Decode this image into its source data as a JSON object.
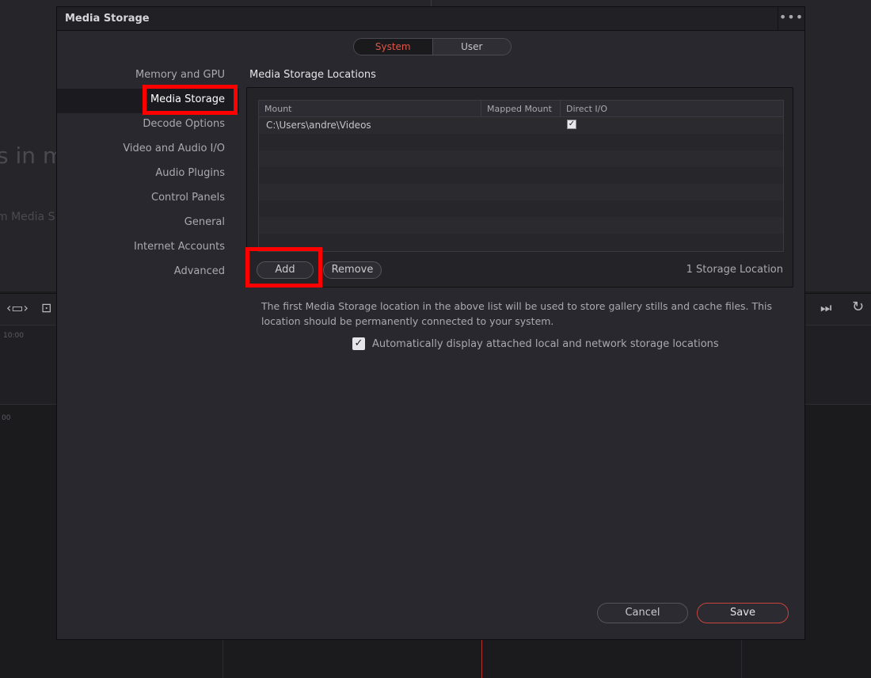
{
  "background": {
    "ghost_heading": "s in m",
    "ghost_subtext": "m Media S",
    "ruler_labels": [
      "10:00",
      "00"
    ]
  },
  "dialog": {
    "title": "Media Storage",
    "menu_icon": "ellipsis-icon",
    "tabs": [
      {
        "label": "System",
        "active": true
      },
      {
        "label": "User",
        "active": false
      }
    ],
    "nav": [
      {
        "label": "Memory and GPU",
        "selected": false
      },
      {
        "label": "Media Storage",
        "selected": true
      },
      {
        "label": "Decode Options",
        "selected": false
      },
      {
        "label": "Video and Audio I/O",
        "selected": false
      },
      {
        "label": "Audio Plugins",
        "selected": false
      },
      {
        "label": "Control Panels",
        "selected": false
      },
      {
        "label": "General",
        "selected": false
      },
      {
        "label": "Internet Accounts",
        "selected": false
      },
      {
        "label": "Advanced",
        "selected": false
      }
    ],
    "section_title": "Media Storage Locations",
    "table": {
      "columns": [
        "Mount",
        "Mapped Mount",
        "Direct I/O"
      ],
      "rows": [
        {
          "mount": "C:\\Users\\andre\\Videos",
          "mapped_mount": "",
          "direct_io": true
        }
      ]
    },
    "add_label": "Add",
    "remove_label": "Remove",
    "storage_count": "1 Storage Location",
    "note": "The first Media Storage location in the above list will be used to store gallery stills and cache files. This location should be permanently connected to your system.",
    "auto_display": {
      "checked": true,
      "label": "Automatically display attached local and network storage locations"
    },
    "cancel_label": "Cancel",
    "save_label": "Save"
  },
  "colors": {
    "accent": "#e0574a",
    "highlight_box": "#ff0000",
    "dialog_bg": "#28282e"
  }
}
